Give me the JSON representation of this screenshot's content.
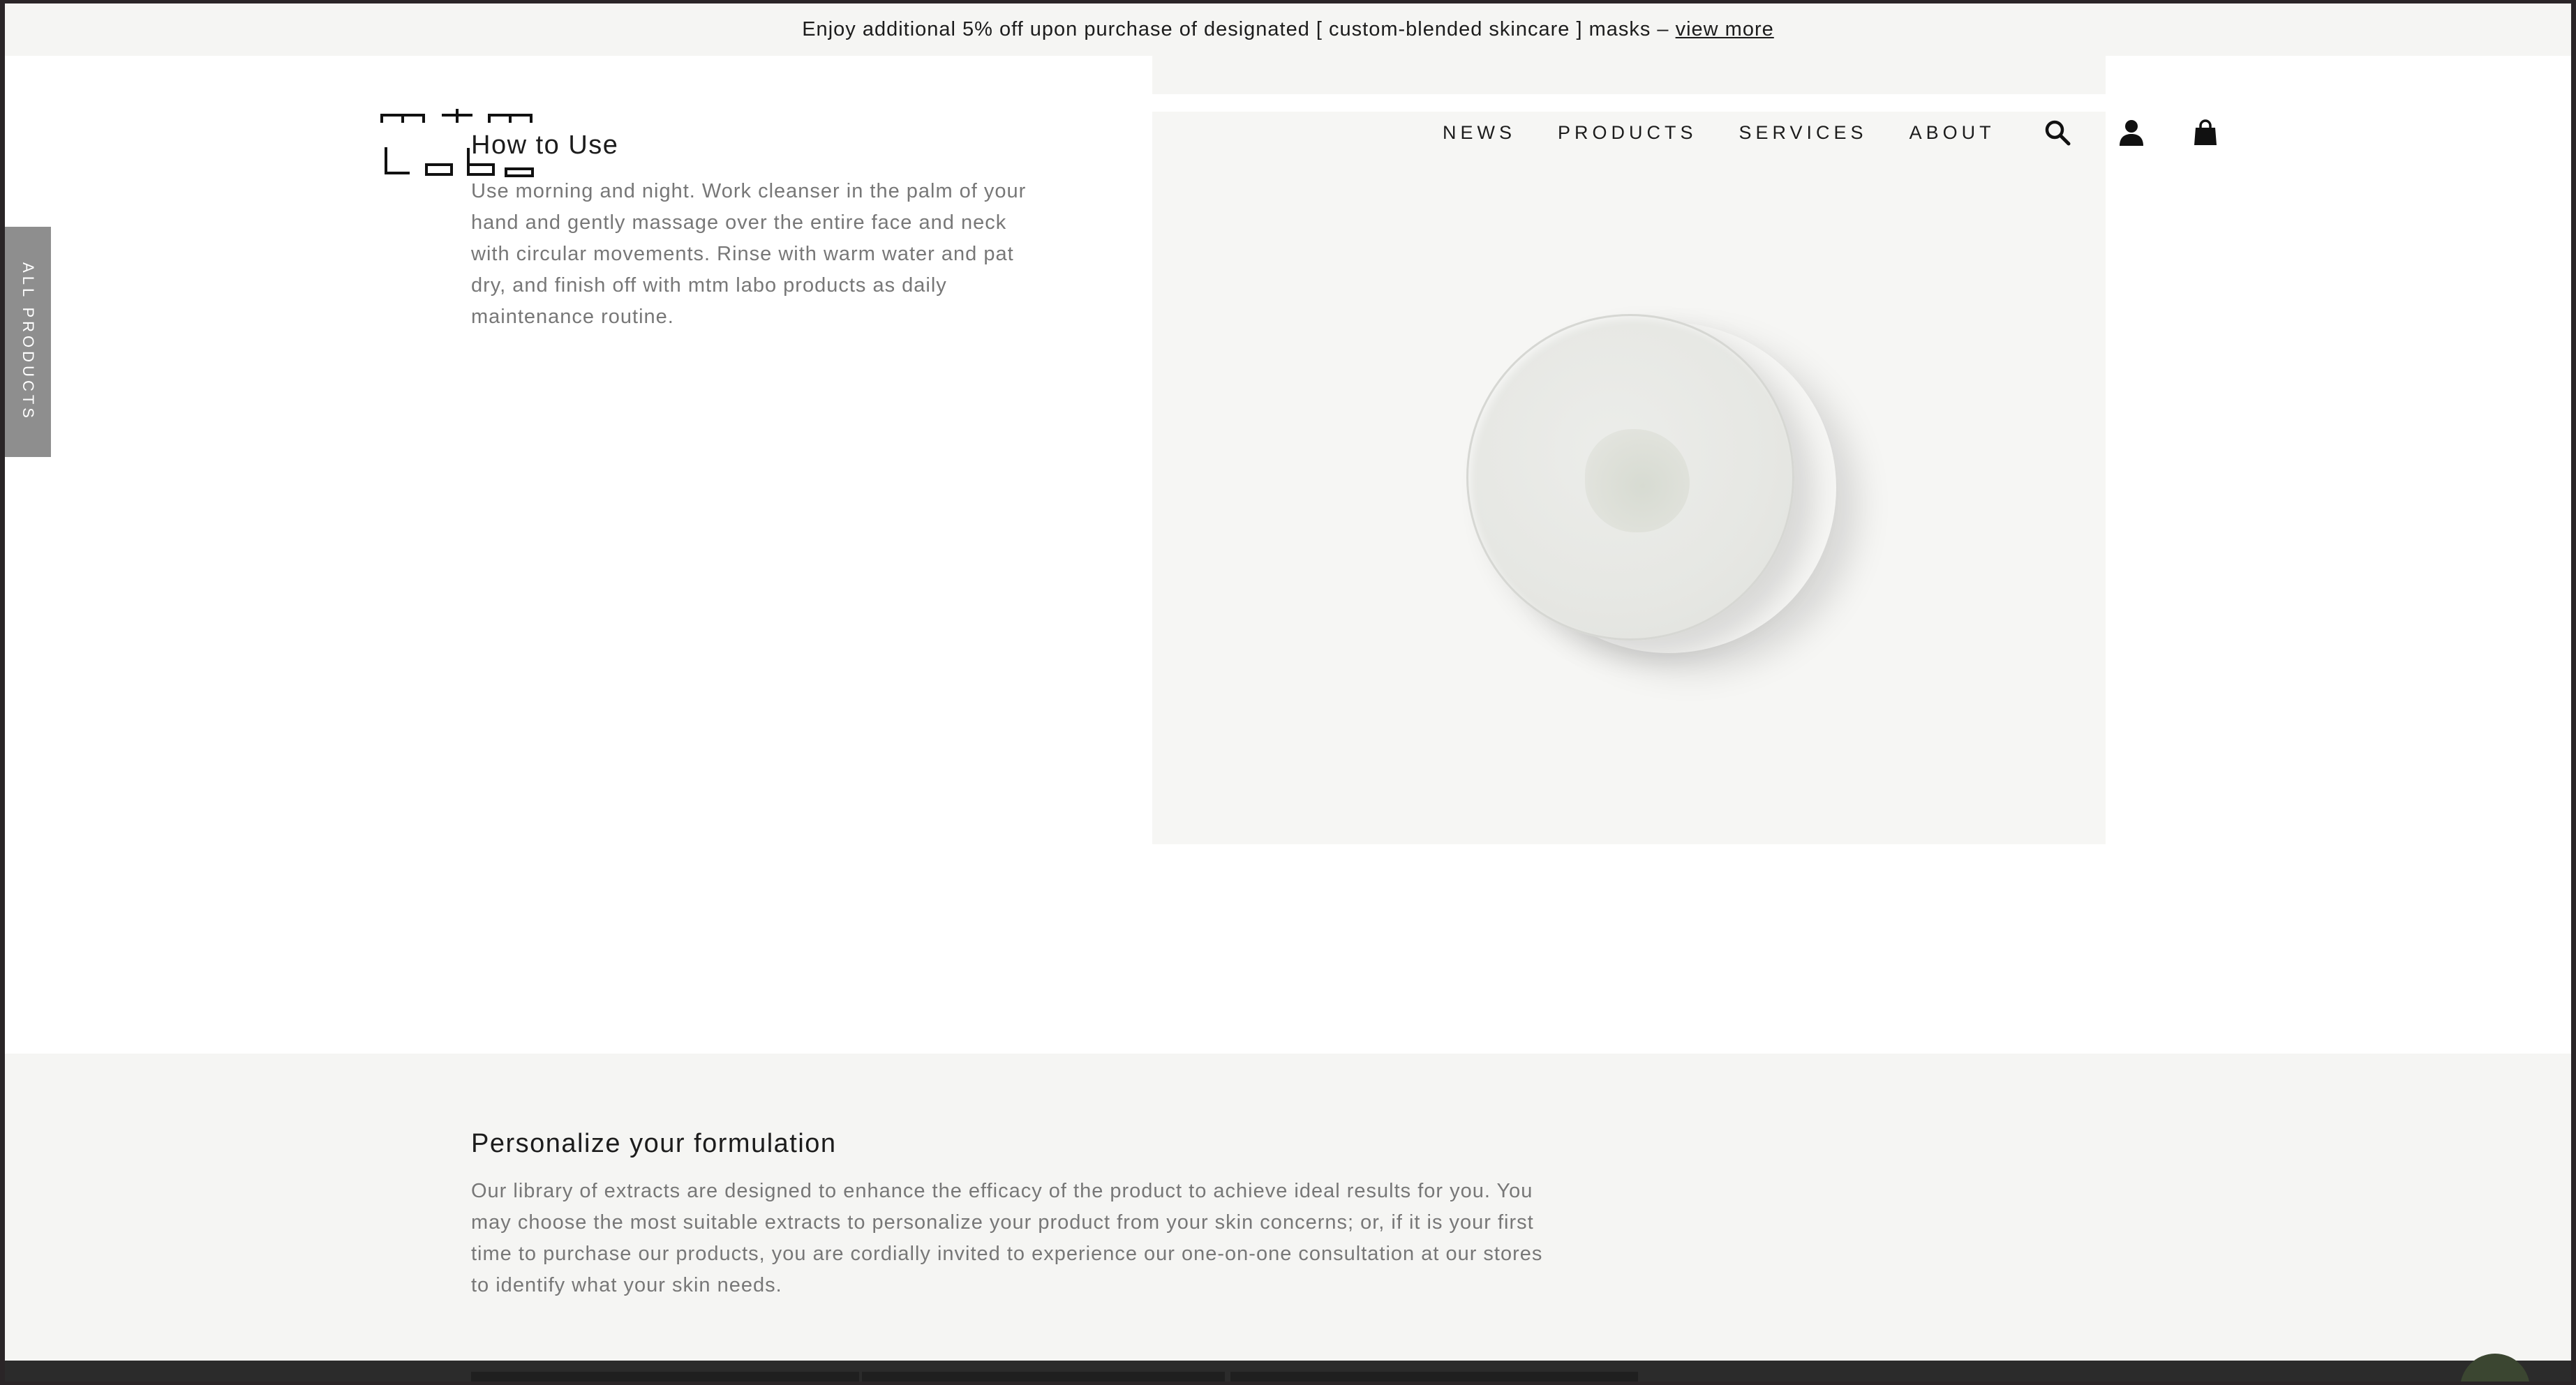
{
  "announcement": {
    "text": "Enjoy additional 5% off upon purchase of designated [ custom-blended skincare ] masks – ",
    "link_label": "view more"
  },
  "logo": {
    "alt": "mtm labo"
  },
  "nav": {
    "items": [
      "NEWS",
      "PRODUCTS",
      "SERVICES",
      "ABOUT"
    ],
    "icons": [
      "search-icon",
      "account-icon",
      "cart-icon"
    ]
  },
  "side_tab": {
    "label": "ALL PRODUCTS"
  },
  "how_to_use": {
    "title": "How to Use",
    "text": "Use morning and night. Work cleanser in the palm of your hand and gently massage over the entire face and neck with circular movements. Rinse with warm water and pat dry, and finish off with mtm labo products as daily maintenance routine."
  },
  "personalize": {
    "title": "Personalize your formulation",
    "text": "Our library of extracts are designed to enhance the efficacy of the product to achieve ideal results for you. You may choose the most suitable extracts to personalize your product from your skin concerns; or, if it is your first time to purchase our products, you are cordially invited to experience our one-on-one consultation at our stores to identify what your skin needs."
  },
  "colors": {
    "announcement_bg": "#f5f5f3",
    "text_primary": "#1c1c1c",
    "text_secondary": "#777777",
    "side_tab_bg": "#8e8e8e",
    "chat_button": "#3b4631"
  }
}
